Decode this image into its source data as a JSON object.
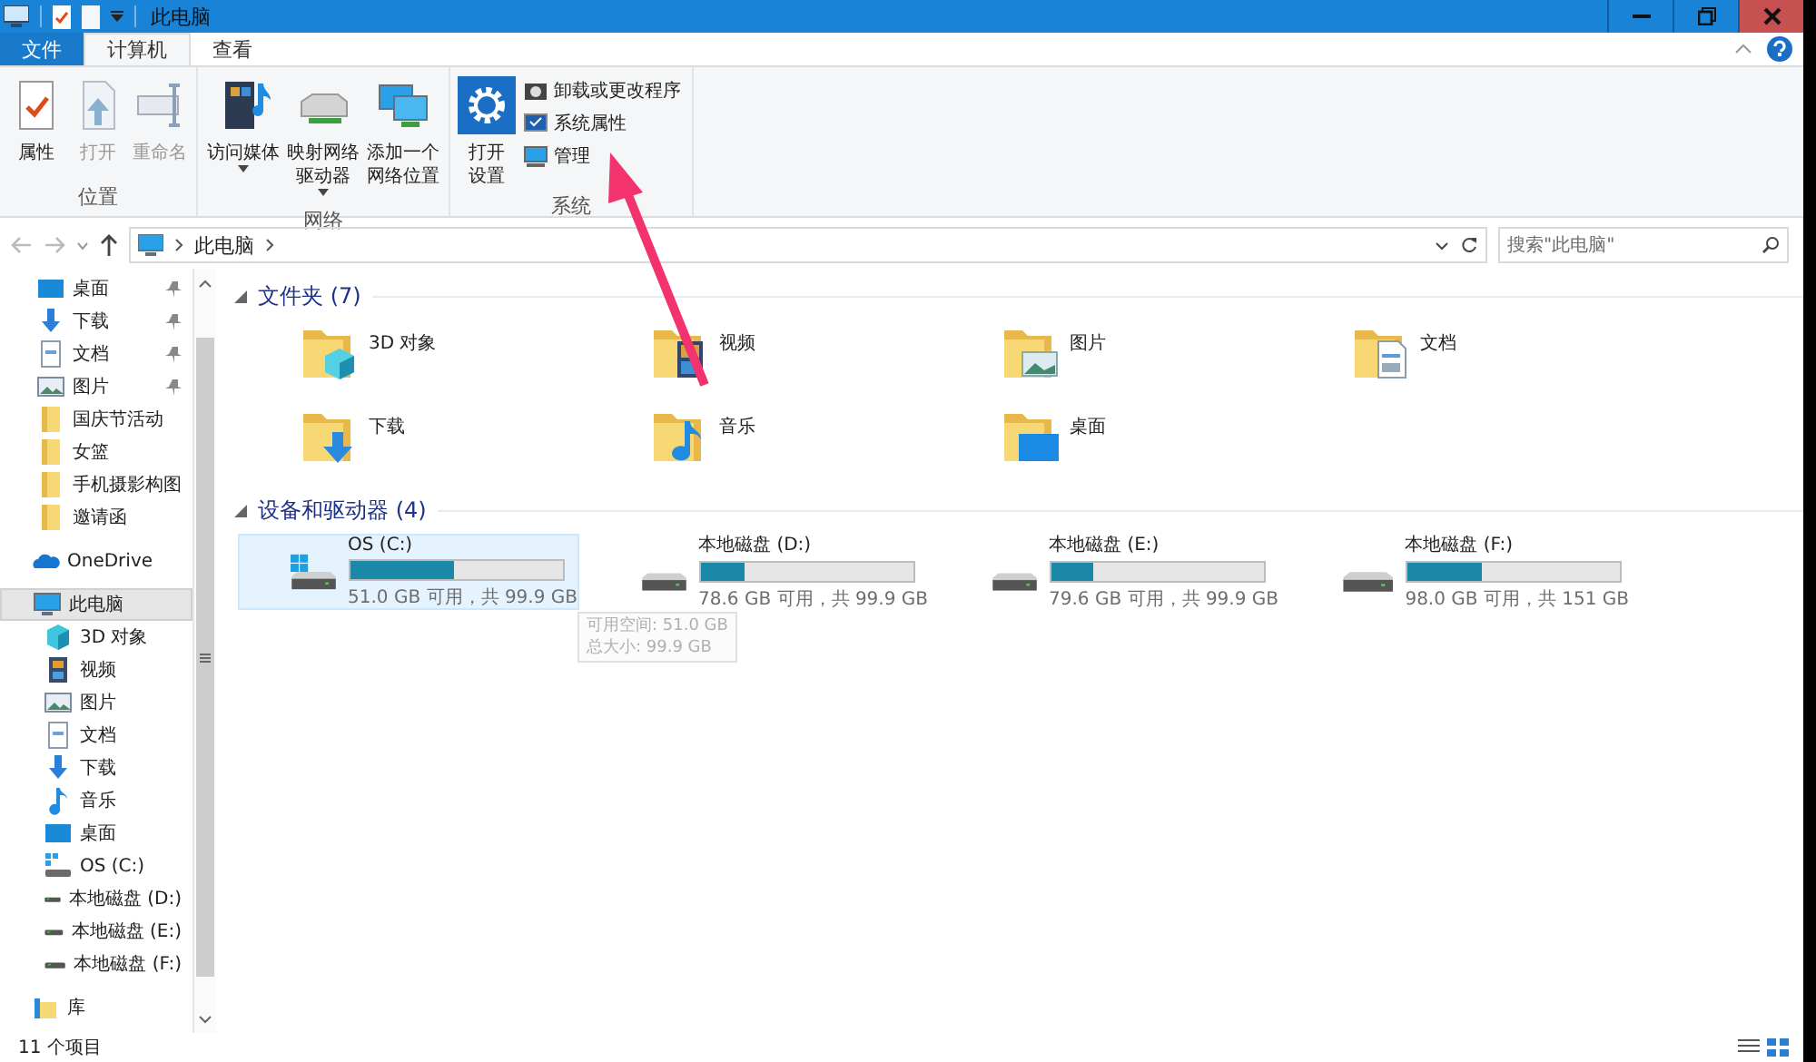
{
  "window": {
    "title": "此电脑"
  },
  "tabs": [
    {
      "label": "文件",
      "kind": "file",
      "selected": false
    },
    {
      "label": "计算机",
      "kind": "tab",
      "selected": true
    },
    {
      "label": "查看",
      "kind": "tab",
      "selected": false
    }
  ],
  "ribbon": {
    "groups": [
      {
        "label": "位置",
        "items": [
          {
            "label": "属性",
            "kind": "props",
            "disabled": false
          },
          {
            "label": "打开",
            "kind": "open",
            "disabled": true
          },
          {
            "label": "重命名",
            "kind": "rename",
            "disabled": true
          }
        ]
      },
      {
        "label": "网络",
        "items": [
          {
            "label": "访问媒体",
            "kind": "media",
            "disabled": false,
            "dropdown": true
          },
          {
            "label": "映射网络驱动器",
            "kind": "mapdrive",
            "disabled": false,
            "dropdown": true
          },
          {
            "label": "添加一个网络位置",
            "kind": "netloc",
            "disabled": false
          }
        ]
      },
      {
        "label": "系统",
        "items": [
          {
            "label": "打开设置",
            "kind": "settings",
            "disabled": false
          },
          {
            "label": "卸载或更改程序",
            "kind": "uninstall",
            "disabled": false
          },
          {
            "label": "系统属性",
            "kind": "sysprops",
            "disabled": false
          },
          {
            "label": "管理",
            "kind": "manage",
            "disabled": false
          }
        ]
      }
    ]
  },
  "address": {
    "path": "此电脑",
    "search_placeholder": "搜索\"此电脑\""
  },
  "sidebar": {
    "items": [
      {
        "label": "桌面",
        "kind": "desktop",
        "pinned": true,
        "selected": false
      },
      {
        "label": "下载",
        "kind": "download",
        "pinned": true,
        "selected": false
      },
      {
        "label": "文档",
        "kind": "doc",
        "pinned": true,
        "selected": false
      },
      {
        "label": "图片",
        "kind": "picture",
        "pinned": true,
        "selected": false
      },
      {
        "label": "国庆节活动",
        "kind": "folder",
        "pinned": false,
        "selected": false
      },
      {
        "label": "女篮",
        "kind": "folder",
        "pinned": false,
        "selected": false
      },
      {
        "label": "手机摄影构图",
        "kind": "folder",
        "pinned": false,
        "selected": false
      },
      {
        "label": "邀请函",
        "kind": "folder",
        "pinned": false,
        "selected": false
      },
      {
        "label": "OneDrive",
        "kind": "onedrive",
        "pinned": false,
        "selected": false
      },
      {
        "label": "此电脑",
        "kind": "pc",
        "pinned": false,
        "selected": true,
        "children": [
          {
            "label": "3D 对象",
            "kind": "cube",
            "pinned": false,
            "selected": false
          },
          {
            "label": "视频",
            "kind": "video",
            "pinned": false,
            "selected": false
          },
          {
            "label": "图片",
            "kind": "picture",
            "pinned": false,
            "selected": false
          },
          {
            "label": "文档",
            "kind": "doc",
            "pinned": false,
            "selected": false
          },
          {
            "label": "下载",
            "kind": "download",
            "pinned": false,
            "selected": false
          },
          {
            "label": "音乐",
            "kind": "music",
            "pinned": false,
            "selected": false
          },
          {
            "label": "桌面",
            "kind": "desktop",
            "pinned": false,
            "selected": false
          },
          {
            "label": "OS (C:)",
            "kind": "osdrive",
            "pinned": false,
            "selected": false
          },
          {
            "label": "本地磁盘 (D:)",
            "kind": "drive",
            "pinned": false,
            "selected": false
          },
          {
            "label": "本地磁盘 (E:)",
            "kind": "drive",
            "pinned": false,
            "selected": false
          },
          {
            "label": "本地磁盘 (F:)",
            "kind": "drive",
            "pinned": false,
            "selected": false
          }
        ]
      },
      {
        "label": "库",
        "kind": "library",
        "pinned": false,
        "selected": false
      }
    ]
  },
  "folders": {
    "heading": "文件夹 (7)",
    "items": [
      {
        "label": "3D 对象",
        "kind": "cube"
      },
      {
        "label": "视频",
        "kind": "video"
      },
      {
        "label": "图片",
        "kind": "picture"
      },
      {
        "label": "文档",
        "kind": "doc"
      },
      {
        "label": "下载",
        "kind": "download"
      },
      {
        "label": "音乐",
        "kind": "music"
      },
      {
        "label": "桌面",
        "kind": "desktop"
      }
    ]
  },
  "drives": {
    "heading": "设备和驱动器 (4)",
    "items": [
      {
        "name": "OS (C:)",
        "kind": "osdrive",
        "level": 0.49,
        "reading": "51.0 GB 可用，共 99.9 GB",
        "selected": true
      },
      {
        "name": "本地磁盘 (D:)",
        "kind": "drive",
        "level": 0.21,
        "reading": "78.6 GB 可用，共 99.9 GB",
        "selected": false
      },
      {
        "name": "本地磁盘 (E:)",
        "kind": "drive",
        "level": 0.2,
        "reading": "79.6 GB 可用，共 99.9 GB",
        "selected": false
      },
      {
        "name": "本地磁盘 (F:)",
        "kind": "drive",
        "level": 0.35,
        "reading": "98.0 GB 可用，共 151 GB",
        "selected": false
      }
    ]
  },
  "tooltip": {
    "lines": [
      "可用空间: 51.0 GB",
      "总大小: 99.9 GB"
    ]
  },
  "status_bar": {
    "count": "11 个项目"
  }
}
